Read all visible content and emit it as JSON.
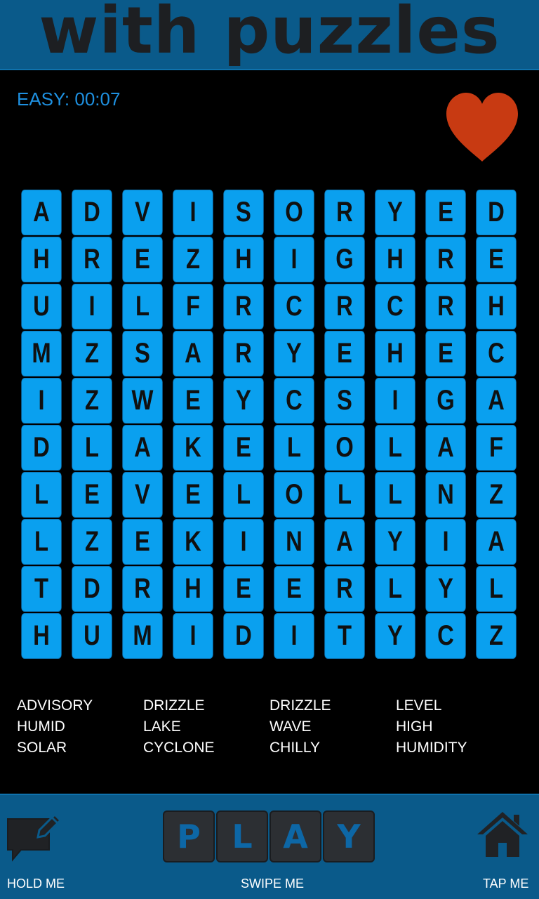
{
  "header": {
    "title": "with puzzles"
  },
  "status": {
    "timer": "EASY: 00:07"
  },
  "icons": {
    "favorite": "heart-icon",
    "hold": "chat-edit-icon",
    "home": "home-icon"
  },
  "colors": {
    "accent": "#0aa0ef",
    "header_bg": "#0a5a8a",
    "heart": "#c83a12",
    "timer": "#1e90e0"
  },
  "grid": {
    "rows": [
      [
        "A",
        "D",
        "V",
        "I",
        "S",
        "O",
        "R",
        "Y",
        "E",
        "D"
      ],
      [
        "H",
        "R",
        "E",
        "Z",
        "H",
        "I",
        "G",
        "H",
        "R",
        "E"
      ],
      [
        "U",
        "I",
        "L",
        "F",
        "R",
        "C",
        "R",
        "C",
        "R",
        "H"
      ],
      [
        "M",
        "Z",
        "S",
        "A",
        "R",
        "Y",
        "E",
        "H",
        "E",
        "C"
      ],
      [
        "I",
        "Z",
        "W",
        "E",
        "Y",
        "C",
        "S",
        "I",
        "G",
        "A"
      ],
      [
        "D",
        "L",
        "A",
        "K",
        "E",
        "L",
        "O",
        "L",
        "A",
        "F"
      ],
      [
        "L",
        "E",
        "V",
        "E",
        "L",
        "O",
        "L",
        "L",
        "N",
        "Z"
      ],
      [
        "L",
        "Z",
        "E",
        "K",
        "I",
        "N",
        "A",
        "Y",
        "I",
        "A"
      ],
      [
        "T",
        "D",
        "R",
        "H",
        "E",
        "E",
        "R",
        "L",
        "Y",
        "L"
      ],
      [
        "H",
        "U",
        "M",
        "I",
        "D",
        "I",
        "T",
        "Y",
        "C",
        "Z"
      ]
    ]
  },
  "words": [
    "ADVISORY",
    "DRIZZLE",
    "DRIZZLE",
    "LEVEL",
    "HUMID",
    "LAKE",
    "WAVE",
    "HIGH",
    "SOLAR",
    "CYCLONE",
    "CHILLY",
    "HUMIDITY"
  ],
  "footer": {
    "play_letters": [
      "P",
      "L",
      "A",
      "Y"
    ],
    "hold_label": "HOLD ME",
    "swipe_label": "SWIPE ME",
    "tap_label": "TAP ME"
  }
}
